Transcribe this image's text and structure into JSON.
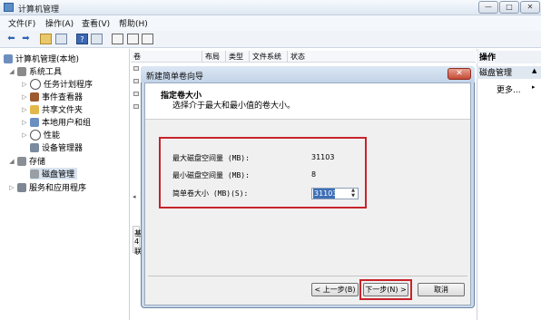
{
  "window": {
    "title": "计算机管理",
    "min_glyph": "—",
    "max_glyph": "□",
    "close_glyph": "✕"
  },
  "menu": [
    "文件(F)",
    "操作(A)",
    "查看(V)",
    "帮助(H)"
  ],
  "tree": {
    "root": "计算机管理(本地)",
    "system_tools": "系统工具",
    "task_scheduler": "任务计划程序",
    "event_viewer": "事件查看器",
    "shared_folders": "共享文件夹",
    "local_users": "本地用户和组",
    "performance": "性能",
    "device_manager": "设备管理器",
    "storage": "存储",
    "disk_management": "磁盘管理",
    "services_apps": "服务和应用程序"
  },
  "list_header": {
    "volume": "卷",
    "layout": "布局",
    "type": "类型",
    "filesystem": "文件系统",
    "status": "状态"
  },
  "lower_partial": [
    "基",
    "4",
    "联"
  ],
  "actions": {
    "header": "操作",
    "section": "磁盘管理",
    "more": "更多..."
  },
  "dialog": {
    "title": "新建简单卷向导",
    "close_glyph": "✕",
    "step_title": "指定卷大小",
    "step_desc": "选择介于最大和最小值的卷大小。",
    "max_label": "最大磁盘空间量 (MB):",
    "max_value": "31103",
    "min_label": "最小磁盘空间量 (MB):",
    "min_value": "8",
    "size_label": "简单卷大小 (MB)(S):",
    "size_value": "31103",
    "back_label": "< 上一步(B)",
    "next_label": "下一步(N) >",
    "cancel_label": "取消"
  }
}
